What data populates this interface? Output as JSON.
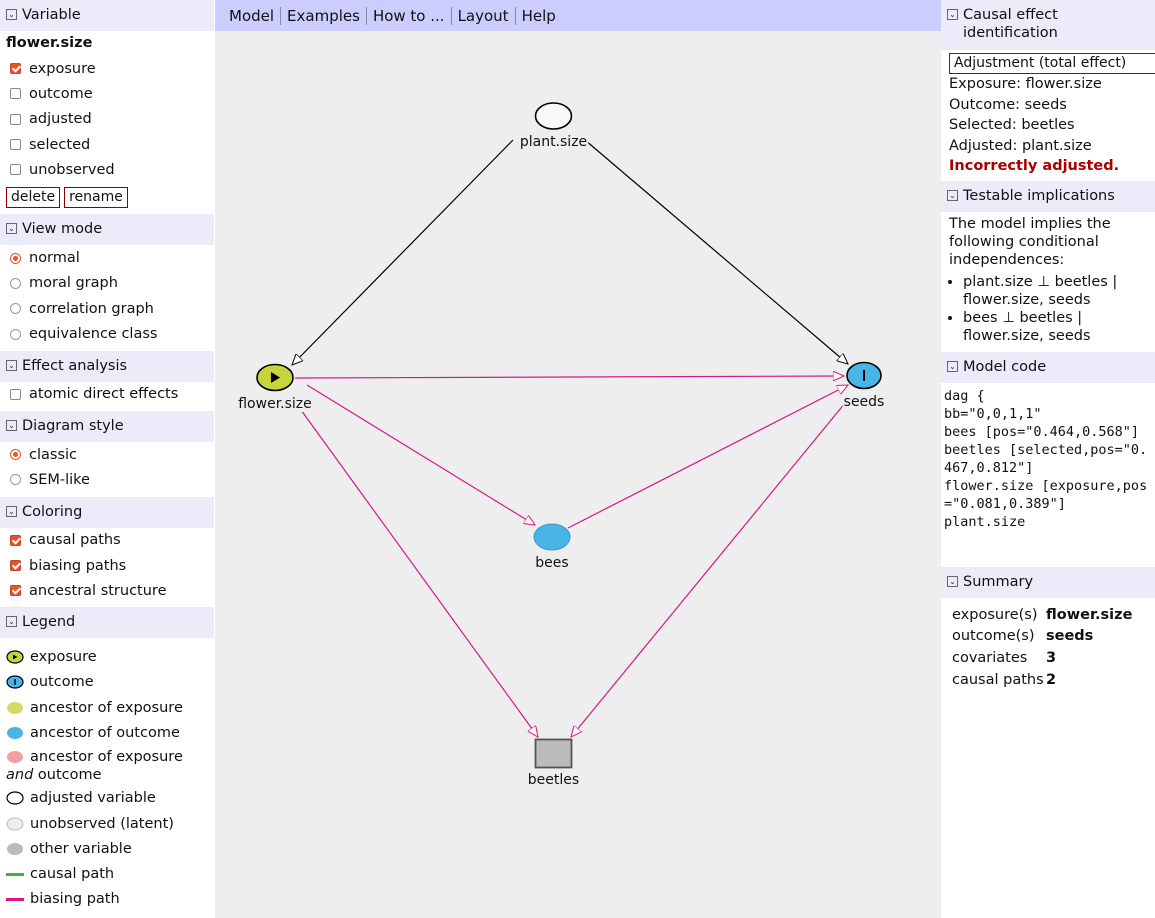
{
  "left": {
    "variable": {
      "title": "Variable",
      "name": "flower.size",
      "checks": [
        {
          "label": "exposure",
          "checked": true
        },
        {
          "label": "outcome",
          "checked": false
        },
        {
          "label": "adjusted",
          "checked": false
        },
        {
          "label": "selected",
          "checked": false
        },
        {
          "label": "unobserved",
          "checked": false
        }
      ],
      "delete_label": "delete",
      "rename_label": "rename"
    },
    "view_mode": {
      "title": "View mode",
      "options": [
        {
          "label": "normal",
          "selected": true
        },
        {
          "label": "moral graph",
          "selected": false
        },
        {
          "label": "correlation graph",
          "selected": false
        },
        {
          "label": "equivalence class",
          "selected": false
        }
      ]
    },
    "effect_analysis": {
      "title": "Effect analysis",
      "checks": [
        {
          "label": "atomic direct effects",
          "checked": false
        }
      ]
    },
    "diagram_style": {
      "title": "Diagram style",
      "options": [
        {
          "label": "classic",
          "selected": true
        },
        {
          "label": "SEM-like",
          "selected": false
        }
      ]
    },
    "coloring": {
      "title": "Coloring",
      "checks": [
        {
          "label": "causal paths",
          "checked": true
        },
        {
          "label": "biasing paths",
          "checked": true
        },
        {
          "label": "ancestral structure",
          "checked": true
        }
      ]
    },
    "legend": {
      "title": "Legend",
      "items": {
        "exposure": "exposure",
        "outcome": "outcome",
        "anc_exposure": "ancestor of exposure",
        "anc_outcome": "ancestor of outcome",
        "anc_both_1": "ancestor of exposure",
        "anc_both_and": "and",
        "anc_both_2": "outcome",
        "adjusted": "adjusted variable",
        "unobserved": "unobserved (latent)",
        "other": "other variable",
        "causal": "causal path",
        "biasing": "biasing path"
      }
    }
  },
  "menu": [
    "Model",
    "Examples",
    "How to ...",
    "Layout",
    "Help"
  ],
  "graph": {
    "nodes": {
      "plant_size": "plant.size",
      "flower_size": "flower.size",
      "seeds": "seeds",
      "bees": "bees",
      "beetles": "beetles"
    }
  },
  "right": {
    "causal": {
      "title": "Causal effect identification",
      "select_value": "Adjustment (total effect)",
      "exposure": "Exposure: flower.size",
      "outcome": "Outcome: seeds",
      "selected": "Selected: beetles",
      "adjusted": "Adjusted: plant.size",
      "status": "Incorrectly adjusted."
    },
    "testable": {
      "title": "Testable implications",
      "intro": "The model implies the following conditional independences:",
      "items": [
        "plant.size ⊥ beetles | flower.size, seeds",
        "bees ⊥ beetles | flower.size, seeds"
      ]
    },
    "model_code": {
      "title": "Model code",
      "code": "dag {\nbb=\"0,0,1,1\"\nbees [pos=\"0.464,0.568\"]\nbeetles [selected,pos=\"0.467,0.812\"]\nflower.size [exposure,pos=\"0.081,0.389\"]\nplant.size"
    },
    "summary": {
      "title": "Summary",
      "rows": [
        {
          "key": "exposure(s)",
          "value": "flower.size"
        },
        {
          "key": "outcome(s)",
          "value": "seeds"
        },
        {
          "key": "covariates",
          "value": "3"
        },
        {
          "key": "causal paths",
          "value": "2"
        }
      ]
    }
  },
  "colors": {
    "exposure": "#c8d43c",
    "outcome": "#49b4e6",
    "anc_exposure": "#d2dc66",
    "anc_outcome": "#49b4e6",
    "anc_both": "#f0a0a0",
    "causal": "#3fb43f",
    "biasing": "#d6168a",
    "menubar": "#ccccff",
    "status_red": "#aa0000"
  }
}
